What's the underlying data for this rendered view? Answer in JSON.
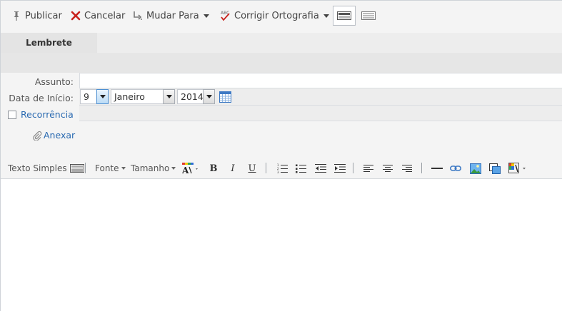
{
  "toolbar": {
    "publish_label": "Publicar",
    "cancel_label": "Cancelar",
    "move_label": "Mudar Para",
    "spell_label": "Corrigir Ortografia"
  },
  "tabs": [
    {
      "label": "Lembrete"
    }
  ],
  "form": {
    "subject_label": "Assunto:",
    "subject_value": "",
    "start_label": "Data de Início:",
    "day": "9",
    "month": "Janeiro",
    "year": "2014",
    "recurrence_label": "Recorrência",
    "recurrence_checked": false,
    "attach_label": "Anexar"
  },
  "format_toolbar": {
    "plain_text_label": "Texto Simples",
    "font_label": "Fonte",
    "size_label": "Tamanho"
  },
  "editor": {
    "body": ""
  },
  "colors": {
    "accent_link": "#2a6ab1",
    "cancel_red": "#c8211b"
  }
}
